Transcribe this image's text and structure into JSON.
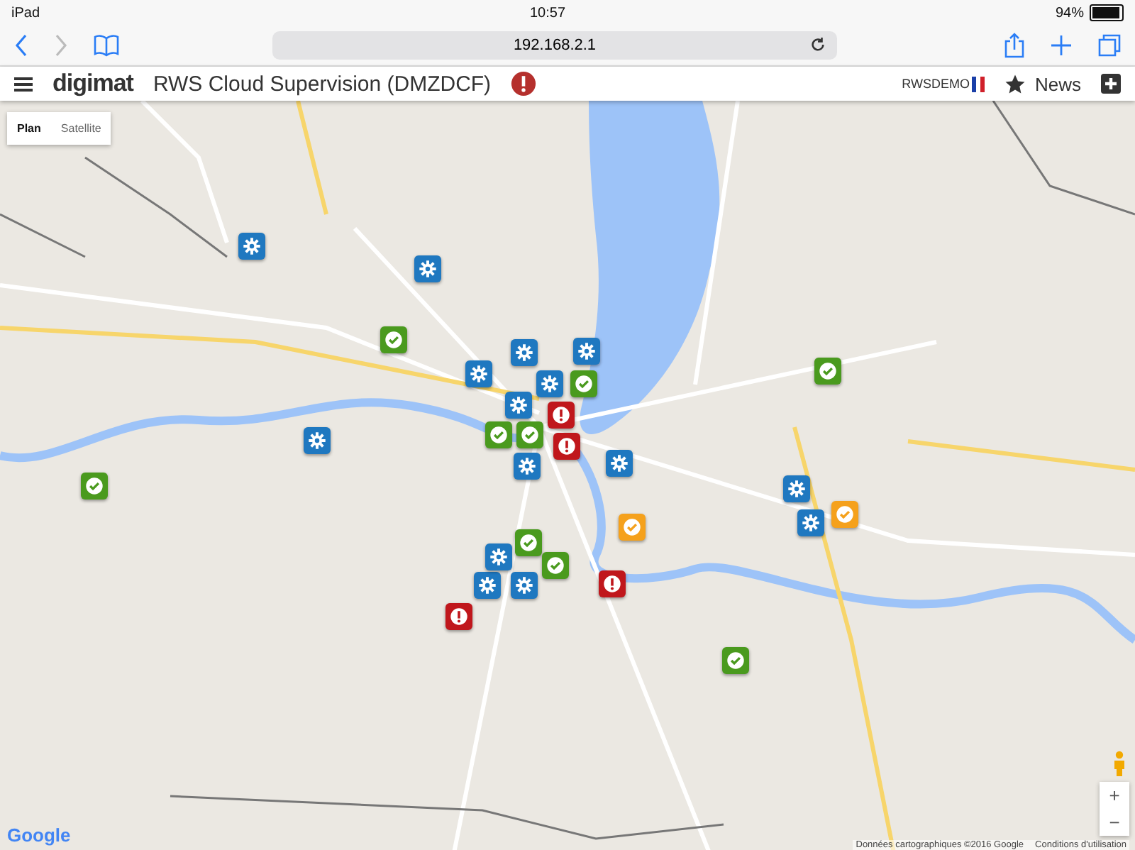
{
  "status_bar": {
    "device": "iPad",
    "time": "10:57",
    "battery": "94%"
  },
  "browser": {
    "url": "192.168.2.1"
  },
  "header": {
    "logo": "digimat",
    "title": "RWS Cloud Supervision (DMZDCF)",
    "user": "RWSDEMO",
    "news": "News"
  },
  "map": {
    "tabs": [
      {
        "label": "Plan",
        "selected": true
      },
      {
        "label": "Satellite",
        "selected": false
      }
    ],
    "markers": [
      {
        "kind": "gear"
      },
      {
        "kind": "gear"
      },
      {
        "kind": "gear"
      },
      {
        "kind": "gear"
      },
      {
        "kind": "gear"
      },
      {
        "kind": "gear"
      },
      {
        "kind": "gear"
      },
      {
        "kind": "gear"
      },
      {
        "kind": "gear"
      },
      {
        "kind": "gear"
      },
      {
        "kind": "gear"
      },
      {
        "kind": "gear"
      },
      {
        "kind": "gear"
      },
      {
        "kind": "gear"
      },
      {
        "kind": "gear"
      },
      {
        "kind": "ok"
      },
      {
        "kind": "ok"
      },
      {
        "kind": "ok"
      },
      {
        "kind": "ok"
      },
      {
        "kind": "ok"
      },
      {
        "kind": "ok"
      },
      {
        "kind": "ok"
      },
      {
        "kind": "ok"
      },
      {
        "kind": "ok"
      },
      {
        "kind": "alert"
      },
      {
        "kind": "alert"
      },
      {
        "kind": "alert"
      },
      {
        "kind": "alert"
      },
      {
        "kind": "ack"
      },
      {
        "kind": "ack"
      }
    ],
    "logo": "Google",
    "zoom_in": "+",
    "zoom_out": "−",
    "attribution": "Données cartographiques ©2016 Google",
    "terms": "Conditions d'utilisation"
  }
}
